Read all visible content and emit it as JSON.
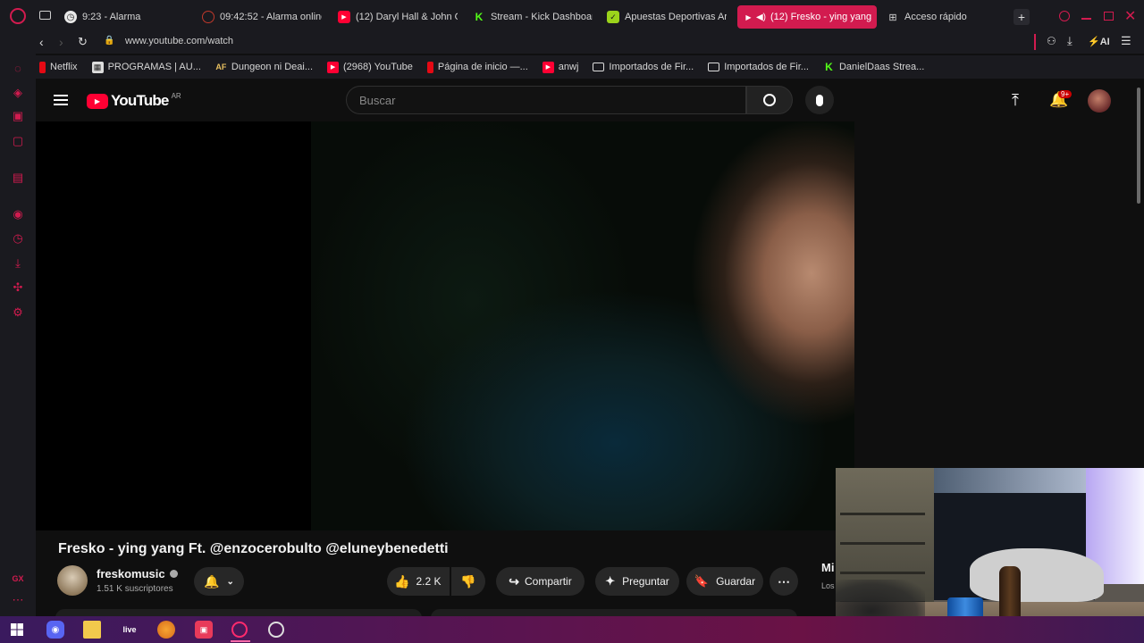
{
  "browser": {
    "tabs": [
      {
        "title": "9:23 - Alarma",
        "icon": "clock-icon"
      },
      {
        "title": "09:42:52 - Alarma online",
        "icon": "record-icon"
      },
      {
        "title": "(12) Daryl Hall & John Oa",
        "icon": "youtube-icon"
      },
      {
        "title": "Stream - Kick Dashboard",
        "icon": "kick-icon"
      },
      {
        "title": "Apuestas Deportivas Ar",
        "icon": "bet-icon"
      },
      {
        "title": "(12) Fresko - ying yang",
        "icon": "youtube-icon"
      },
      {
        "title": "Acceso rápido",
        "icon": "grid-icon"
      }
    ],
    "url": "www.youtube.com/watch",
    "ai_label": "AI",
    "bookmarks": [
      {
        "label": "Netflix",
        "icon": "netflix-icon"
      },
      {
        "label": "PROGRAMAS | AU...",
        "icon": "image-icon"
      },
      {
        "label": "Dungeon ni Deai...",
        "icon": "af-icon"
      },
      {
        "label": "(2968) YouTube",
        "icon": "youtube-icon"
      },
      {
        "label": "Página de inicio —...",
        "icon": "netflix-icon"
      },
      {
        "label": "anwj",
        "icon": "youtube-icon"
      },
      {
        "label": "Importados de Fir...",
        "icon": "folder-icon"
      },
      {
        "label": "Importados de Fir...",
        "icon": "folder-icon"
      },
      {
        "label": "DanielDaas Strea...",
        "icon": "kick-icon"
      }
    ],
    "accent": "#d21b4f"
  },
  "youtube": {
    "logo_text": "YouTube",
    "region": "AR",
    "search_placeholder": "Buscar",
    "notif_badge": "9+",
    "video_title": "Fresko - ying yang Ft. @enzocerobulto @eluneybenedetti",
    "channel_name": "freskomusic",
    "subscribers": "1.51 K suscriptores",
    "likes": "2.2 K",
    "share_label": "Compartir",
    "ask_label": "Preguntar",
    "save_label": "Guardar",
    "side_text": "Mi",
    "side_subtext": "Los"
  },
  "taskbar": {
    "live_label": "live"
  }
}
